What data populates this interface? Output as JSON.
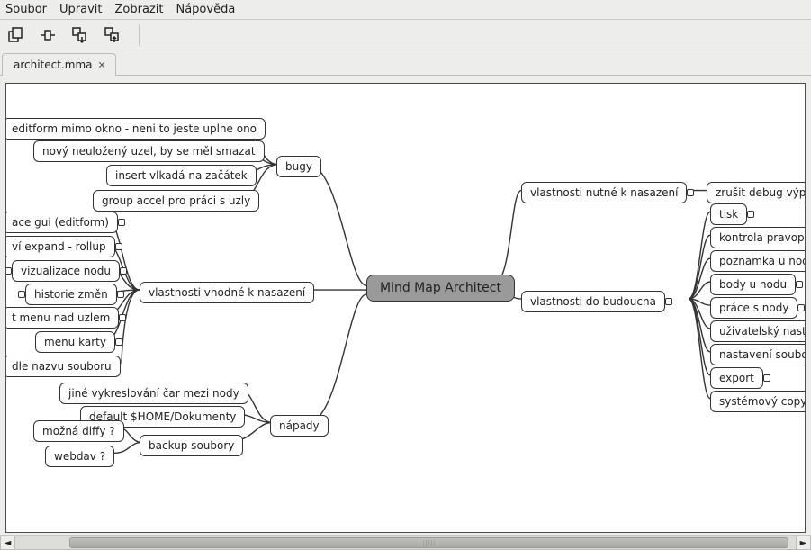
{
  "menu": {
    "file": {
      "mnemonic": "S",
      "rest": "oubor"
    },
    "edit": {
      "mnemonic": "U",
      "rest": "pravit"
    },
    "view": {
      "mnemonic": "Z",
      "rest": "obrazit"
    },
    "help": {
      "mnemonic": "N",
      "rest": "ápověda"
    }
  },
  "tab": {
    "label": "architect.mma"
  },
  "nodes": {
    "center": "Mind Map Architect",
    "bugy": "bugy",
    "bugy_children": {
      "b1": "editform mimo okno - neni to jeste uplne ono",
      "b2": "nový neuložený uzel, by se měl smazat",
      "b3": "insert vlkadá na začátek",
      "b4": "group accel pro práci s uzly"
    },
    "vhodne": "vlastnosti vhodné k nasazení",
    "vhodne_children": {
      "v1": "ace gui (editform)",
      "v2": "ví expand - rollup",
      "v3": "vizualizace nodu",
      "v4": "historie změn",
      "v5": "t menu nad uzlem",
      "v6": "menu karty",
      "v7": "dle nazvu souboru"
    },
    "napady": "nápady",
    "napady_children": {
      "n1": "jiné vykreslování čar mezi nody",
      "n2": "default $HOME/Dokumenty",
      "n3": "backup soubory",
      "n4": "možná diffy ?",
      "n5": "webdav ?"
    },
    "nutne": "vlastnosti nutné k nasazení",
    "nutne_children": {
      "nu1": "zrušit debug výpisy"
    },
    "budoucna": "vlastnosti do budoucna",
    "budoucna_children": {
      "f1": "tisk",
      "f2": "kontrola pravopisu",
      "f3": "poznamka u nodu",
      "f4": "body u nodu",
      "f5": "práce s nody",
      "f6": "uživatelský nastave",
      "f7": "nastavení souboru",
      "f8": "export",
      "f9": "systémový copybor"
    }
  }
}
